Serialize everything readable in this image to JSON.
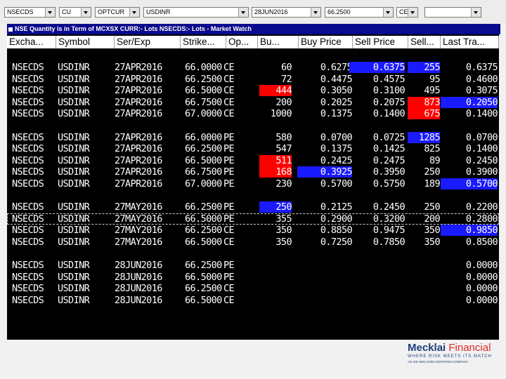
{
  "toolbar": {
    "exchange": "NSECDS",
    "instrument_class": "CU",
    "instrument_type": "OPTCUR",
    "symbol": "USDINR",
    "expiry": "28JUN2016",
    "strike": "66.2500",
    "option_type": "CE",
    "extra": ""
  },
  "window": {
    "title": "NSE  Quantity is in Term of  MCXSX CURR:- Lots NSECDS:- Lots - Market Watch"
  },
  "columns": [
    "Excha...",
    "Symbol",
    "Ser/Exp",
    "Strike...",
    "Op...",
    "Bu...",
    "Buy Price",
    "Sell Price",
    "Sell...",
    "Last Tra..."
  ],
  "rows": [
    {
      "ex": "NSECDS",
      "sym": "USDINR",
      "exp": "27APR2016",
      "strike": "66.0000",
      "opt": "CE",
      "bq": "60",
      "bp": "0.6275",
      "sp": "0.6375",
      "sq": "255",
      "ltp": "0.6375",
      "hl": {
        "sp": "blue",
        "sq": "blue"
      }
    },
    {
      "ex": "NSECDS",
      "sym": "USDINR",
      "exp": "27APR2016",
      "strike": "66.2500",
      "opt": "CE",
      "bq": "72",
      "bp": "0.4475",
      "sp": "0.4575",
      "sq": "95",
      "ltp": "0.4600",
      "hl": {}
    },
    {
      "ex": "NSECDS",
      "sym": "USDINR",
      "exp": "27APR2016",
      "strike": "66.5000",
      "opt": "CE",
      "bq": "444",
      "bp": "0.3050",
      "sp": "0.3100",
      "sq": "495",
      "ltp": "0.3075",
      "hl": {
        "bq": "red"
      }
    },
    {
      "ex": "NSECDS",
      "sym": "USDINR",
      "exp": "27APR2016",
      "strike": "66.7500",
      "opt": "CE",
      "bq": "200",
      "bp": "0.2025",
      "sp": "0.2075",
      "sq": "873",
      "ltp": "0.2050",
      "hl": {
        "sq": "red",
        "ltp": "blue"
      }
    },
    {
      "ex": "NSECDS",
      "sym": "USDINR",
      "exp": "27APR2016",
      "strike": "67.0000",
      "opt": "CE",
      "bq": "1000",
      "bp": "0.1375",
      "sp": "0.1400",
      "sq": "675",
      "ltp": "0.1400",
      "hl": {
        "sq": "red"
      }
    },
    {
      "blank": true
    },
    {
      "ex": "NSECDS",
      "sym": "USDINR",
      "exp": "27APR2016",
      "strike": "66.0000",
      "opt": "PE",
      "bq": "580",
      "bp": "0.0700",
      "sp": "0.0725",
      "sq": "1285",
      "ltp": "0.0700",
      "hl": {
        "sq": "blue"
      }
    },
    {
      "ex": "NSECDS",
      "sym": "USDINR",
      "exp": "27APR2016",
      "strike": "66.2500",
      "opt": "PE",
      "bq": "547",
      "bp": "0.1375",
      "sp": "0.1425",
      "sq": "825",
      "ltp": "0.1400",
      "hl": {}
    },
    {
      "ex": "NSECDS",
      "sym": "USDINR",
      "exp": "27APR2016",
      "strike": "66.5000",
      "opt": "PE",
      "bq": "511",
      "bp": "0.2425",
      "sp": "0.2475",
      "sq": "89",
      "ltp": "0.2450",
      "hl": {
        "bq": "red"
      }
    },
    {
      "ex": "NSECDS",
      "sym": "USDINR",
      "exp": "27APR2016",
      "strike": "66.7500",
      "opt": "PE",
      "bq": "168",
      "bp": "0.3925",
      "sp": "0.3950",
      "sq": "250",
      "ltp": "0.3900",
      "hl": {
        "bq": "red",
        "bp": "blue"
      }
    },
    {
      "ex": "NSECDS",
      "sym": "USDINR",
      "exp": "27APR2016",
      "strike": "67.0000",
      "opt": "PE",
      "bq": "230",
      "bp": "0.5700",
      "sp": "0.5750",
      "sq": "189",
      "ltp": "0.5700",
      "hl": {
        "ltp": "blue"
      }
    },
    {
      "blank": true
    },
    {
      "ex": "NSECDS",
      "sym": "USDINR",
      "exp": "27MAY2016",
      "strike": "66.2500",
      "opt": "PE",
      "bq": "250",
      "bp": "0.2125",
      "sp": "0.2450",
      "sq": "250",
      "ltp": "0.2200",
      "hl": {
        "bq": "blue"
      }
    },
    {
      "ex": "NSECDS",
      "sym": "USDINR",
      "exp": "27MAY2016",
      "strike": "66.5000",
      "opt": "PE",
      "bq": "355",
      "bp": "0.2900",
      "sp": "0.3200",
      "sq": "200",
      "ltp": "0.2800",
      "hl": {},
      "selected": true
    },
    {
      "ex": "NSECDS",
      "sym": "USDINR",
      "exp": "27MAY2016",
      "strike": "66.2500",
      "opt": "CE",
      "bq": "350",
      "bp": "0.8850",
      "sp": "0.9475",
      "sq": "350",
      "ltp": "0.9850",
      "hl": {
        "ltp": "blue"
      }
    },
    {
      "ex": "NSECDS",
      "sym": "USDINR",
      "exp": "27MAY2016",
      "strike": "66.5000",
      "opt": "CE",
      "bq": "350",
      "bp": "0.7250",
      "sp": "0.7850",
      "sq": "350",
      "ltp": "0.8500",
      "hl": {}
    },
    {
      "blank": true
    },
    {
      "ex": "NSECDS",
      "sym": "USDINR",
      "exp": "28JUN2016",
      "strike": "66.2500",
      "opt": "PE",
      "bq": "",
      "bp": "",
      "sp": "",
      "sq": "",
      "ltp": "0.0000",
      "hl": {}
    },
    {
      "ex": "NSECDS",
      "sym": "USDINR",
      "exp": "28JUN2016",
      "strike": "66.5000",
      "opt": "PE",
      "bq": "",
      "bp": "",
      "sp": "",
      "sq": "",
      "ltp": "0.0000",
      "hl": {}
    },
    {
      "ex": "NSECDS",
      "sym": "USDINR",
      "exp": "28JUN2016",
      "strike": "66.2500",
      "opt": "CE",
      "bq": "",
      "bp": "",
      "sp": "",
      "sq": "",
      "ltp": "0.0000",
      "hl": {}
    },
    {
      "ex": "NSECDS",
      "sym": "USDINR",
      "exp": "28JUN2016",
      "strike": "66.5000",
      "opt": "CE",
      "bq": "",
      "bp": "",
      "sp": "",
      "sq": "",
      "ltp": "0.0000",
      "hl": {}
    }
  ],
  "logo": {
    "brand_main": "Mecklai",
    "brand_accent": "Financial",
    "tagline": "WHERE RISK MEETS ITS MATCH",
    "sub": "AN ISO 9001:2008 CERTIFIED COMPANY"
  },
  "colors": {
    "highlight_red": "#ff0000",
    "highlight_blue": "#1a1aff",
    "title_bar": "#0a0a8c",
    "grid_bg": "#000000"
  }
}
